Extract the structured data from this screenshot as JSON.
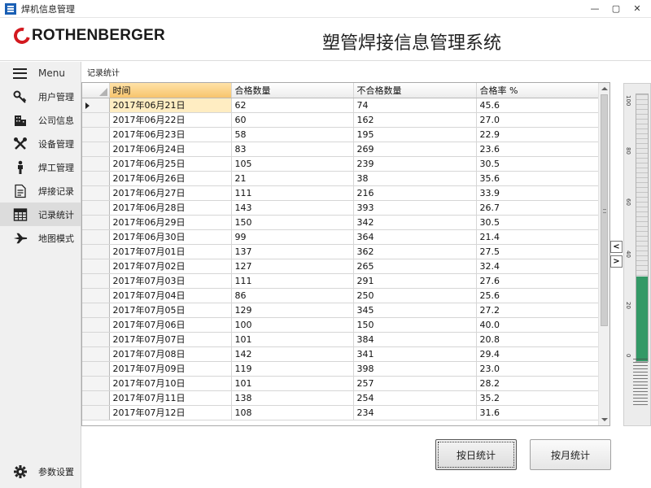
{
  "window": {
    "title": "焊机信息管理",
    "controls": [
      "—",
      "▢",
      "✕"
    ]
  },
  "header": {
    "brand": "ROTHENBERGER",
    "app_title": "塑管焊接信息管理系统"
  },
  "sidebar": {
    "menu_label": "Menu",
    "items": [
      {
        "label": "用户管理",
        "icon": "key-icon"
      },
      {
        "label": "公司信息",
        "icon": "building-icon"
      },
      {
        "label": "设备管理",
        "icon": "tools-icon"
      },
      {
        "label": "焊工管理",
        "icon": "person-icon"
      },
      {
        "label": "焊接记录",
        "icon": "document-icon"
      },
      {
        "label": "记录统计",
        "icon": "table-icon",
        "active": true
      },
      {
        "label": "地图模式",
        "icon": "airplane-icon"
      }
    ],
    "settings_label": "参数设置"
  },
  "main": {
    "section_title": "记录统计",
    "columns": [
      "时间",
      "合格数量",
      "不合格数量",
      "合格率 %"
    ],
    "rows": [
      [
        "2017年06月21日",
        "62",
        "74",
        "45.6"
      ],
      [
        "2017年06月22日",
        "60",
        "162",
        "27.0"
      ],
      [
        "2017年06月23日",
        "58",
        "195",
        "22.9"
      ],
      [
        "2017年06月24日",
        "83",
        "269",
        "23.6"
      ],
      [
        "2017年06月25日",
        "105",
        "239",
        "30.5"
      ],
      [
        "2017年06月26日",
        "21",
        "38",
        "35.6"
      ],
      [
        "2017年06月27日",
        "111",
        "216",
        "33.9"
      ],
      [
        "2017年06月28日",
        "143",
        "393",
        "26.7"
      ],
      [
        "2017年06月29日",
        "150",
        "342",
        "30.5"
      ],
      [
        "2017年06月30日",
        "99",
        "364",
        "21.4"
      ],
      [
        "2017年07月01日",
        "137",
        "362",
        "27.5"
      ],
      [
        "2017年07月02日",
        "127",
        "265",
        "32.4"
      ],
      [
        "2017年07月03日",
        "111",
        "291",
        "27.6"
      ],
      [
        "2017年07月04日",
        "86",
        "250",
        "25.6"
      ],
      [
        "2017年07月05日",
        "129",
        "345",
        "27.2"
      ],
      [
        "2017年07月06日",
        "100",
        "150",
        "40.0"
      ],
      [
        "2017年07月07日",
        "101",
        "384",
        "20.8"
      ],
      [
        "2017年07月08日",
        "142",
        "341",
        "29.4"
      ],
      [
        "2017年07月09日",
        "119",
        "398",
        "23.0"
      ],
      [
        "2017年07月10日",
        "101",
        "257",
        "28.2"
      ],
      [
        "2017年07月11日",
        "138",
        "254",
        "35.2"
      ],
      [
        "2017年07月12日",
        "108",
        "234",
        "31.6"
      ]
    ]
  },
  "gauge": {
    "ticks": [
      "100",
      "80",
      "60",
      "40",
      "20",
      "0"
    ],
    "level_percent": 31.6,
    "fill_color": "#339966"
  },
  "nav_arrows": {
    "left": "<",
    "right": ">"
  },
  "buttons": {
    "daily": "按日统计",
    "monthly": "按月统计"
  }
}
